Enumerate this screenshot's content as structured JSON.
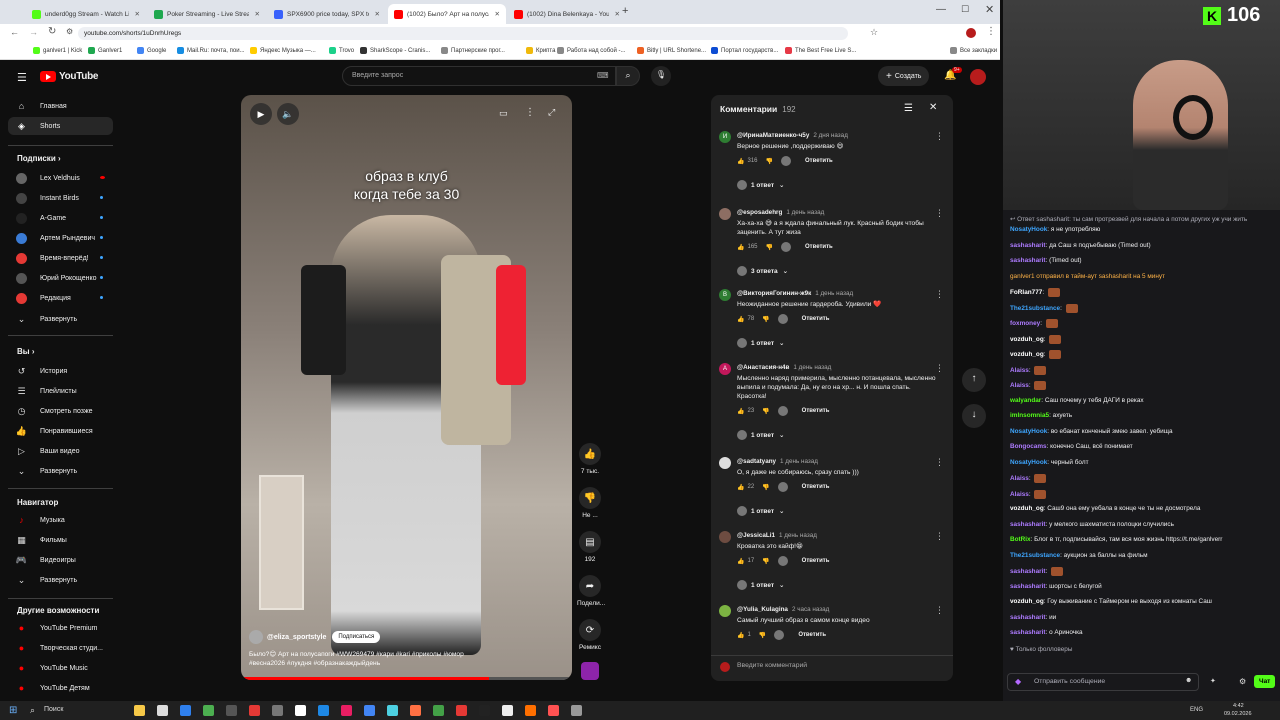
{
  "tabs": [
    {
      "title": "underd0gg Stream - Watch Liv",
      "color": "#53fc18"
    },
    {
      "title": "Poker Streaming - Live Stream",
      "color": "#1fa84f"
    },
    {
      "title": "SPX6900 price today, SPX to U",
      "color": "#3861fb"
    },
    {
      "title": "(1002) Было? Арт на полусап",
      "color": "#ff0000"
    },
    {
      "title": "(1002) Dina Belenkaya - YouTu",
      "color": "#ff0000"
    }
  ],
  "address": "youtube.com/shorts/1uDnrhUregs",
  "bookmarks": [
    {
      "label": "ganlver1 | Kick",
      "color": "#53fc18"
    },
    {
      "label": "Ganlver1",
      "color": "#1fa84f"
    },
    {
      "label": "Google",
      "color": "#4285f4"
    },
    {
      "label": "Mail.Ru: почта, пои...",
      "color": "#168de2"
    },
    {
      "label": "Яндекс Музыка —...",
      "color": "#ffcc00"
    },
    {
      "label": "Trovo",
      "color": "#1bd18a"
    },
    {
      "label": "SharkScope - Cranis...",
      "color": "#333"
    },
    {
      "label": "Партнерские прог...",
      "color": "#888"
    },
    {
      "label": "Крипта",
      "color": "#f0b90b"
    },
    {
      "label": "Работа над собой -...",
      "color": "#888"
    },
    {
      "label": "Bitly | URL Shortene...",
      "color": "#ee6123"
    },
    {
      "label": "Портал государств...",
      "color": "#0d4cd3"
    },
    {
      "label": "The Best Free Live S...",
      "color": "#e63946"
    },
    {
      "label": "Все закладки",
      "color": "#888"
    }
  ],
  "yt": {
    "logo": "YouTube",
    "search_placeholder": "Введите запрос",
    "create": "Создать",
    "notif_badge": "9+",
    "nav": {
      "home": "Главная",
      "shorts": "Shorts"
    },
    "subs_header": "Подписки",
    "subs": [
      {
        "name": "Lex Veldhuis",
        "color": "#666",
        "badge": "live"
      },
      {
        "name": "Instant Birds",
        "color": "#444"
      },
      {
        "name": "A-Game",
        "color": "#222"
      },
      {
        "name": "Артем Рындевич",
        "color": "#3a7bd5"
      },
      {
        "name": "Время-вперёд!",
        "color": "#e53935"
      },
      {
        "name": "Юрий Рокощенко",
        "color": "#555"
      },
      {
        "name": "Редакция",
        "color": "#e53935"
      }
    ],
    "expand": "Развернуть",
    "you_header": "Вы",
    "you": [
      "История",
      "Плейлисты",
      "Смотреть позже",
      "Понравившиеся",
      "Ваши видео",
      "Развернуть"
    ],
    "nav_header": "Навигатор",
    "navigator": [
      "Музыка",
      "Фильмы",
      "Видеоигры",
      "Развернуть"
    ],
    "more_header": "Другие возможности",
    "more": [
      "YouTube Premium",
      "Творческая студи...",
      "YouTube Music",
      "YouTube Детям"
    ]
  },
  "video": {
    "overlay_line1": "образ в клуб",
    "overlay_line2": "когда тебе за 30",
    "channel": "@eliza_sportstyle",
    "subscribe": "Подписаться",
    "caption_line1": "Было?😊 Арт на полусапоги #WW269479 #кари #kari #приколы #юмор",
    "caption_line2": "#весна2026 #лукдня #образнакаждыйдень",
    "likes": "7 тыс.",
    "dislike": "Не ...",
    "comments": "192",
    "share": "Подели...",
    "remix": "Ремикс"
  },
  "comments": {
    "title": "Комментарии",
    "count": "192",
    "reply": "Ответить",
    "input_placeholder": "Введите комментарий",
    "items": [
      {
        "author": "@ИринаМатвиенко-ч5у",
        "time": "2 дня назад",
        "text": "Верное решение ,поддерживаю 😄",
        "likes": "316",
        "replies": "1 ответ",
        "av": "И",
        "avc": "#2e7d32"
      },
      {
        "author": "@esposadehrg",
        "time": "1 день назад",
        "text": "Ха-ха-ха 😅 а я ждала финальный лук. Красный бодик чтобы заценить. А тут жиза",
        "likes": "165",
        "replies": "3 ответа",
        "av": "",
        "avc": "#8d6e63"
      },
      {
        "author": "@ВикторияГогинин-ж9к",
        "time": "1 день назад",
        "text": "Неожиданное решение гардероба. Удивили ❤️",
        "likes": "78",
        "replies": "1 ответ",
        "av": "В",
        "avc": "#2e7d32"
      },
      {
        "author": "@Анастасия-н4в",
        "time": "1 день назад",
        "text": "Мысленно наряд примерила, мысленно потанцевала, мысленно выпила и подумала: Да, ну его на хр... н. И пошла спать. Красотка!",
        "likes": "23",
        "replies": "1 ответ",
        "av": "А",
        "avc": "#c2185b"
      },
      {
        "author": "@sadtatyany",
        "time": "1 день назад",
        "text": "О, я даже не собираюсь, сразу спать )))",
        "likes": "22",
        "replies": "1 ответ",
        "av": "",
        "avc": "#ddd"
      },
      {
        "author": "@JessicaLi1",
        "time": "1 день назад",
        "text": "Кроватка это кайф!😁",
        "likes": "17",
        "replies": "1 ответ",
        "av": "",
        "avc": "#6d4c41"
      },
      {
        "author": "@Yulia_Kulagina",
        "time": "2 часа назад",
        "text": "Самый лучший образ в самом конце видео",
        "likes": "1",
        "replies": "",
        "av": "",
        "avc": "#7cb342"
      }
    ]
  },
  "kick": {
    "viewers": "106"
  },
  "chat": {
    "reply_notice": "Ответ sashasharit: ты сам протрезвей для начала а потом других уж учи жить",
    "lines": [
      {
        "u": "NosatyHook",
        "uc": "#3ea6ff",
        "t": "я не употребляю"
      },
      {
        "u": "sashasharit",
        "uc": "#ad7bff",
        "t": "да Саш я подъебываю (Timed out)"
      },
      {
        "u": "sashasharit",
        "uc": "#ad7bff",
        "t": "(Timed out)"
      },
      {
        "u": "",
        "uc": "#ffb347",
        "t": "ganlver1 отправил в тайм-аут sashasharit на 5 минут"
      },
      {
        "u": "FoRlan777",
        "uc": "#ffffff",
        "t": ""
      },
      {
        "u": "The21substance",
        "uc": "#3ea6ff",
        "t": ""
      },
      {
        "u": "foxmoney",
        "uc": "#ad7bff",
        "t": ""
      },
      {
        "u": "vozduh_og",
        "uc": "#ffffff",
        "t": ""
      },
      {
        "u": "vozduh_og",
        "uc": "#ffffff",
        "t": ""
      },
      {
        "u": "Alaiss",
        "uc": "#ad7bff",
        "t": ""
      },
      {
        "u": "Alaiss",
        "uc": "#ad7bff",
        "t": ""
      },
      {
        "u": "walyandar",
        "uc": "#53fc18",
        "t": "Саш почему у тебя ДАГИ в реках"
      },
      {
        "u": "imInsomnia5",
        "uc": "#53fc18",
        "t": "ахуеть"
      },
      {
        "u": "NosatyHook",
        "uc": "#3ea6ff",
        "t": "во ебанат конченый змею завел. уебища"
      },
      {
        "u": "Bongocams",
        "uc": "#ad7bff",
        "t": "конечно Саш, всё понимает"
      },
      {
        "u": "NosatyHook",
        "uc": "#3ea6ff",
        "t": "черный болт"
      },
      {
        "u": "Alaiss",
        "uc": "#ad7bff",
        "t": ""
      },
      {
        "u": "Alaiss",
        "uc": "#ad7bff",
        "t": ""
      },
      {
        "u": "vozduh_og",
        "uc": "#ffffff",
        "t": "Саш9 она ему уебала в конце че ты не досмотрела"
      },
      {
        "u": "sashasharit",
        "uc": "#ad7bff",
        "t": "у мелкого шахматиста полоцки случились"
      },
      {
        "u": "BotRix",
        "uc": "#53fc18",
        "t": "Блог в тг, подписывайся, там вся моя жизнь https://t.me/ganlverr"
      },
      {
        "u": "The21substance",
        "uc": "#3ea6ff",
        "t": "аукцион за баллы на фильм"
      },
      {
        "u": "sashasharit",
        "uc": "#ad7bff",
        "t": ""
      },
      {
        "u": "sashasharit",
        "uc": "#ad7bff",
        "t": "шортсы с белугой"
      },
      {
        "u": "vozduh_og",
        "uc": "#ffffff",
        "t": "Гоу выживание с Таймером не выходя из комнаты Саш"
      },
      {
        "u": "sashasharit",
        "uc": "#ad7bff",
        "t": "ии"
      },
      {
        "u": "sashasharit",
        "uc": "#ad7bff",
        "t": "о Ариночка"
      }
    ],
    "followers_only": "Только фолловеры",
    "input_placeholder": "Отправить сообщение",
    "chat_button": "Чат"
  },
  "taskbar": {
    "search": "Поиск",
    "lang": "ENG",
    "time": "4:42",
    "date": "09.02.2026"
  }
}
